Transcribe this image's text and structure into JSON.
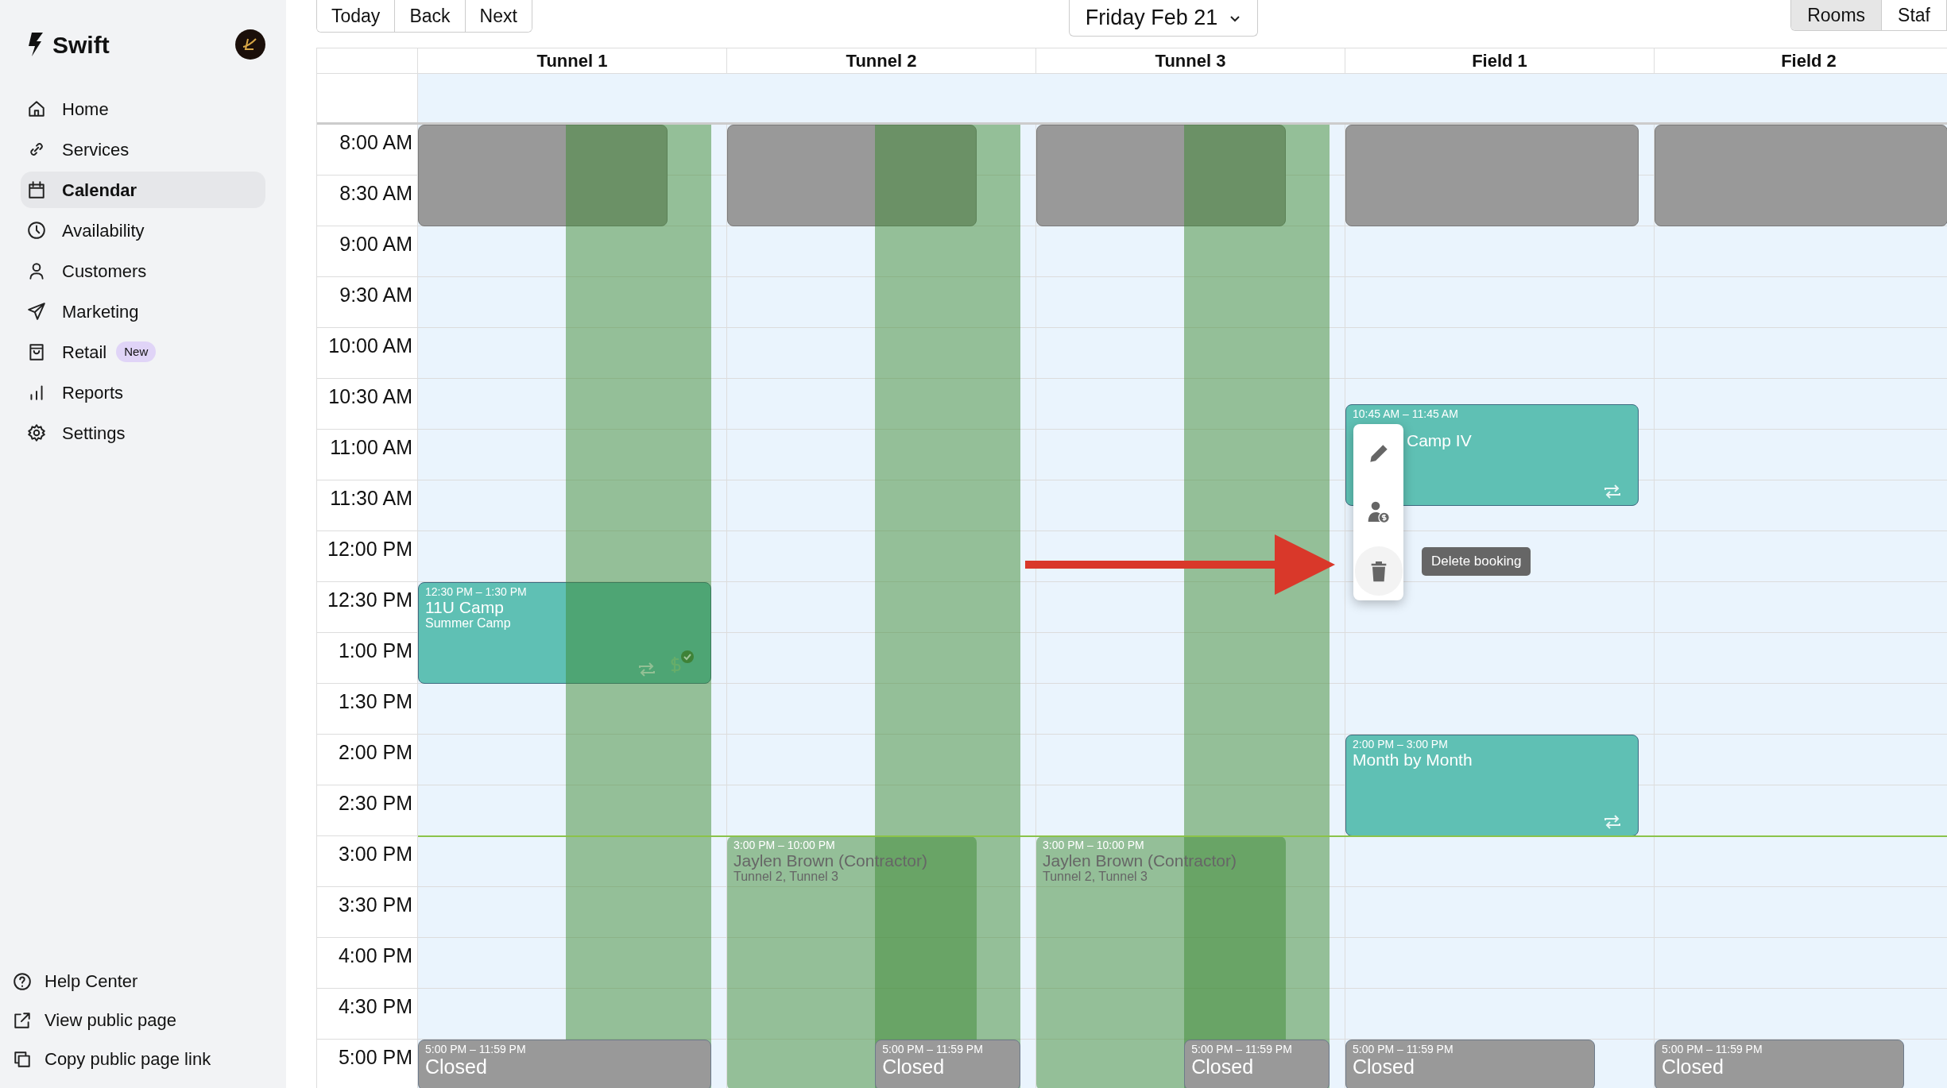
{
  "sidebar": {
    "brand": "Swift",
    "nav": [
      {
        "label": "Home",
        "kind": "home",
        "selected": false
      },
      {
        "label": "Services",
        "kind": "link",
        "selected": false
      },
      {
        "label": "Calendar",
        "kind": "calendar",
        "selected": true
      },
      {
        "label": "Availability",
        "kind": "clock",
        "selected": false
      },
      {
        "label": "Customers",
        "kind": "person",
        "selected": false
      },
      {
        "label": "Marketing",
        "kind": "send",
        "selected": false
      },
      {
        "label": "Retail",
        "kind": "bag",
        "selected": false,
        "badge": "New"
      },
      {
        "label": "Reports",
        "kind": "bars",
        "selected": false
      },
      {
        "label": "Settings",
        "kind": "gear",
        "selected": false
      }
    ],
    "footer_links": [
      {
        "label": "Help Center",
        "kind": "help"
      },
      {
        "label": "View public page",
        "kind": "external"
      },
      {
        "label": "Copy public page link",
        "kind": "copy"
      }
    ]
  },
  "toolbar": {
    "nav_buttons": [
      "Today",
      "Back",
      "Next"
    ],
    "date": "Friday Feb 21",
    "view_toggle": [
      {
        "label": "Rooms",
        "selected": true
      },
      {
        "label": "Staf",
        "selected": false
      }
    ]
  },
  "calendar": {
    "time_labels": [
      "8:00 AM",
      "8:30 AM",
      "9:00 AM",
      "9:30 AM",
      "10:00 AM",
      "10:30 AM",
      "11:00 AM",
      "11:30 AM",
      "12:00 PM",
      "12:30 PM",
      "1:00 PM",
      "1:30 PM",
      "2:00 PM",
      "2:30 PM",
      "3:00 PM",
      "3:30 PM",
      "4:00 PM",
      "4:30 PM",
      "5:00 PM"
    ],
    "current_time_line": true,
    "annotation_arrow": true,
    "columns": [
      {
        "name": "Tunnel 1",
        "staff_available": true,
        "events": [
          {
            "kind": "blocked"
          },
          {
            "kind": "booking",
            "time": "12:30 PM – 1:30 PM",
            "title": "11U Camp",
            "subtitle": "Summer Camp",
            "repeat": true,
            "paid": true
          },
          {
            "kind": "closed",
            "time": "5:00 PM – 11:59 PM",
            "title": "Closed"
          }
        ]
      },
      {
        "name": "Tunnel 2",
        "staff_available": true,
        "events": [
          {
            "kind": "blocked"
          },
          {
            "kind": "staff",
            "time": "3:00 PM – 10:00 PM",
            "title": "Jaylen Brown (Contractor)",
            "subtitle": "Tunnel 2, Tunnel 3"
          },
          {
            "kind": "closed",
            "time": "5:00 PM – 11:59 PM",
            "title": "Closed"
          }
        ]
      },
      {
        "name": "Tunnel 3",
        "staff_available": true,
        "events": [
          {
            "kind": "blocked"
          },
          {
            "kind": "staff",
            "time": "3:00 PM – 10:00 PM",
            "title": "Jaylen Brown (Contractor)",
            "subtitle": "Tunnel 2, Tunnel 3"
          },
          {
            "kind": "closed",
            "time": "5:00 PM – 11:59 PM",
            "title": "Closed"
          }
        ]
      },
      {
        "name": "Field 1",
        "staff_available": false,
        "events": [
          {
            "kind": "blocked"
          },
          {
            "kind": "booking",
            "time": "10:45 AM – 11:45 AM",
            "title": "Camp IV",
            "repeat": true,
            "menu": {
              "actions": [
                {
                  "kind": "edit",
                  "hovered": false
                },
                {
                  "kind": "customer-payment",
                  "hovered": false
                },
                {
                  "kind": "delete",
                  "hovered": true
                }
              ],
              "tooltip": "Delete booking"
            }
          },
          {
            "kind": "booking",
            "time": "2:00 PM – 3:00 PM",
            "title": "Month by Month",
            "repeat": true
          },
          {
            "kind": "closed",
            "time": "5:00 PM – 11:59 PM",
            "title": "Closed"
          }
        ]
      },
      {
        "name": "Field 2",
        "staff_available": false,
        "events": [
          {
            "kind": "blocked"
          },
          {
            "kind": "closed",
            "time": "5:00 PM – 11:59 PM",
            "title": "Closed"
          }
        ]
      }
    ]
  }
}
